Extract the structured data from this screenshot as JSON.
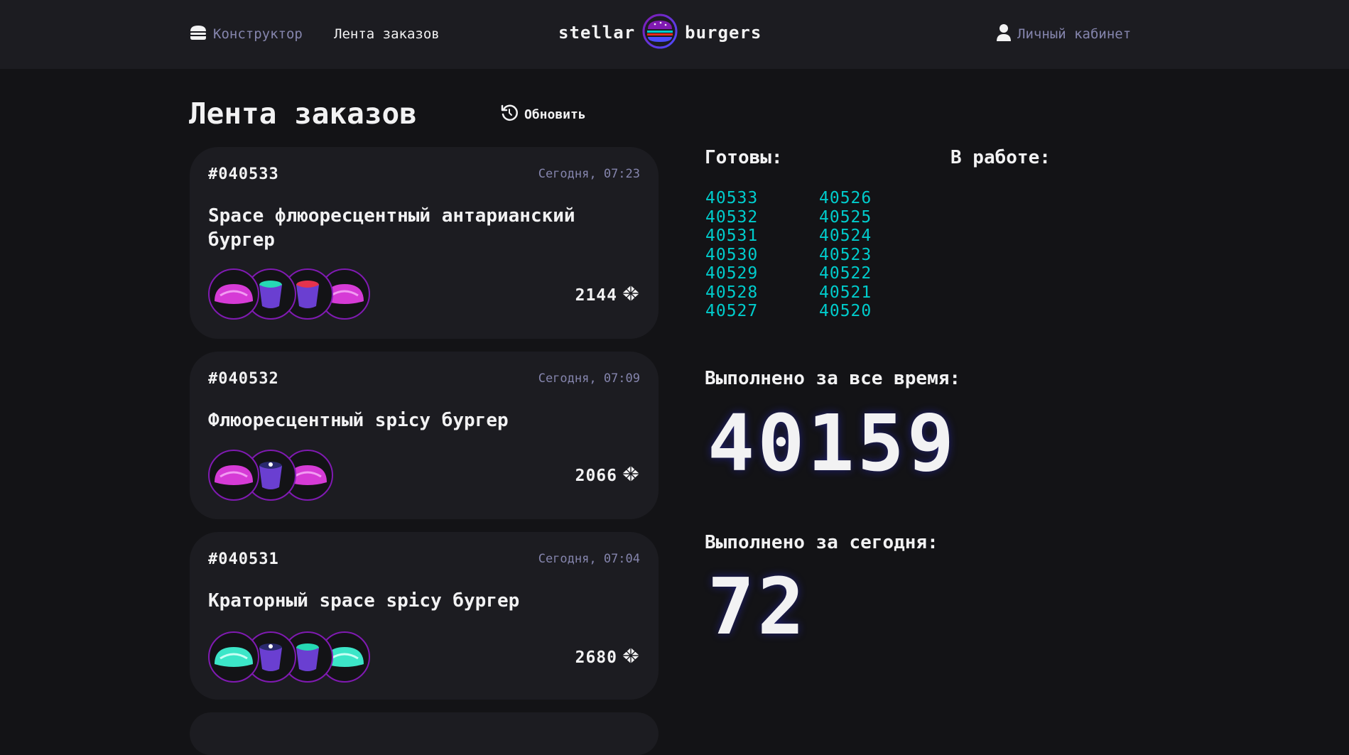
{
  "colors": {
    "background": "#131316",
    "surface": "#1c1c21",
    "inactive_text": "#8585ad",
    "ready_number": "#00cccc",
    "accent_border": "#801ab2"
  },
  "header": {
    "constructor_label": "Конструктор",
    "constructor_icon": "burger-icon",
    "feed_label": "Лента заказов",
    "feed_icon": "list-icon",
    "logo_left": "stellar",
    "logo_right": "burgers",
    "profile_label": "Личный кабинет",
    "profile_icon": "user-icon"
  },
  "page": {
    "title": "Лента заказов",
    "refresh_label": "Обновить",
    "refresh_icon": "refresh-icon"
  },
  "orders": [
    {
      "number": "#040533",
      "date": "Сегодня, 07:23",
      "name": "Space флюоресцентный антарианский бургер",
      "price": "2144",
      "ingredients": [
        "bun-pink",
        "sauce-teal",
        "sauce-red",
        "bun-pink"
      ]
    },
    {
      "number": "#040532",
      "date": "Сегодня, 07:09",
      "name": "Флюоресцентный spicy бургер",
      "price": "2066",
      "ingredients": [
        "bun-pink",
        "sauce-spicy",
        "bun-pink"
      ]
    },
    {
      "number": "#040531",
      "date": "Сегодня, 07:04",
      "name": "Краторный space spicy бургер",
      "price": "2680",
      "ingredients": [
        "bun-teal",
        "sauce-spicy",
        "sauce-teal",
        "bun-teal"
      ]
    }
  ],
  "stats": {
    "ready_label": "Готовы:",
    "in_progress_label": "В работе:",
    "ready_col1": [
      "40533",
      "40532",
      "40531",
      "40530",
      "40529",
      "40528",
      "40527"
    ],
    "ready_col2": [
      "40526",
      "40525",
      "40524",
      "40523",
      "40522",
      "40521",
      "40520"
    ],
    "total_label": "Выполнено за все время:",
    "total_value": "40159",
    "today_label": "Выполнено за сегодня:",
    "today_value": "72"
  }
}
